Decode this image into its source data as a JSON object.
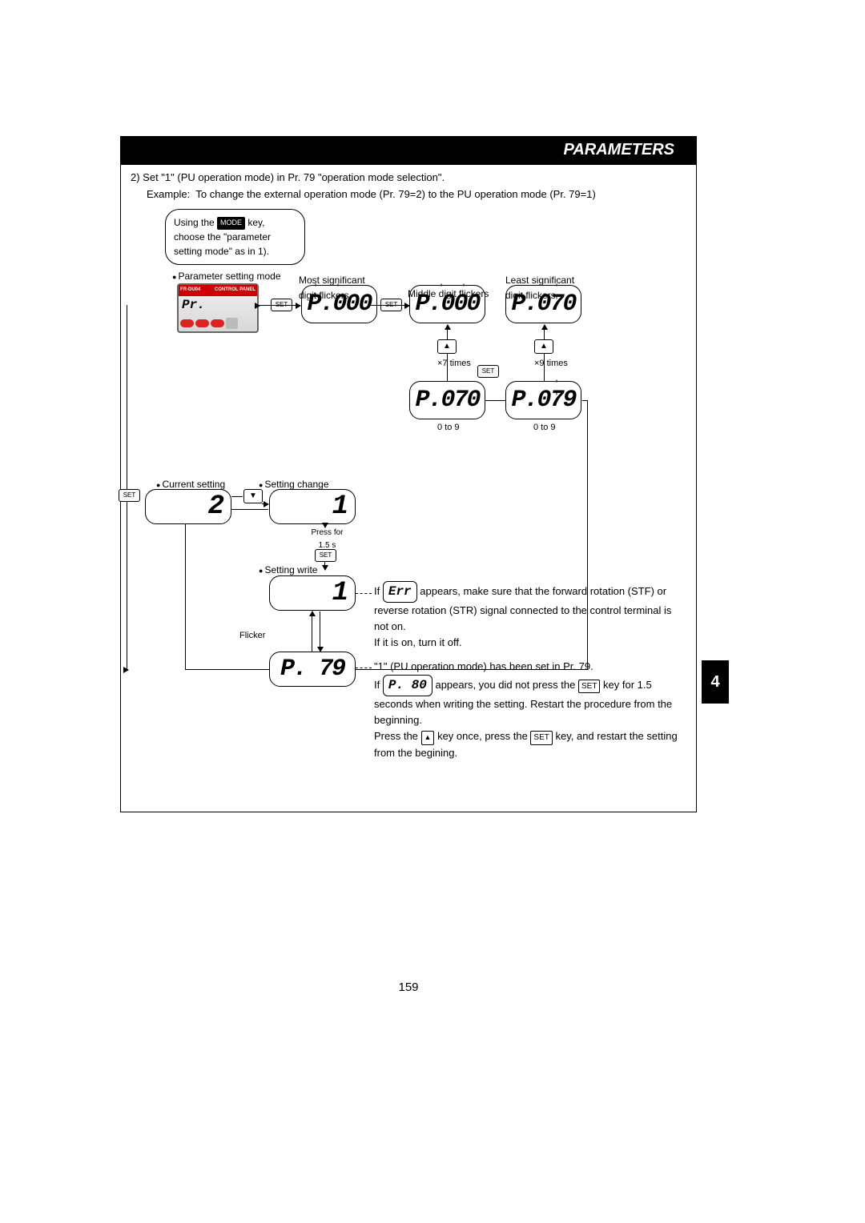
{
  "header": {
    "title": "PARAMETERS"
  },
  "intro": {
    "step": "2) Set \"1\" (PU operation mode) in Pr. 79 \"operation mode selection\".",
    "example": "Example:  To change the external operation mode (Pr. 79=2) to the PU operation mode (Pr. 79=1)"
  },
  "bubble": {
    "l1a": "Using the ",
    "key_mode": "MODE",
    "l1b": " key,",
    "l2": "choose the \"parameter",
    "l3": "setting mode\" as in 1)."
  },
  "panel": {
    "model": "FR-DU04",
    "ctrl": "CONTROL PANEL",
    "pr": "Pr."
  },
  "labels": {
    "param_mode": "Parameter setting mode",
    "msd1": "Most significant",
    "msd2": "digit flickers",
    "mid": "Middle digit flickers",
    "lsd1": "Least significant",
    "lsd2": "digit flickers",
    "x7": "×7 times",
    "x9": "×9 times",
    "range09_a": "0 to 9",
    "range09_b": "0 to 9",
    "current": "Current setting",
    "change": "Setting change",
    "press_for": "Press for",
    "time": "1.5 s",
    "write": "Setting write",
    "flicker": "Flicker"
  },
  "lcd": {
    "p000a": "P.000",
    "p000b": "P.000",
    "p070": "P.070",
    "p070b": "P.070",
    "p079": "P.079",
    "two": "2",
    "one": "1",
    "one2": "1",
    "p79": "P.  79"
  },
  "seg": {
    "err": "Err",
    "p80": "P.  80"
  },
  "btn": {
    "set": "SET"
  },
  "note1": {
    "a": "If ",
    "b": " appears, make sure that the forward rotation (STF) or reverse rotation (STR) signal connected to the control terminal is not on.",
    "c": "If it is on, turn it off."
  },
  "note2": {
    "a": "\"1\" (PU operation mode) has been set in Pr. 79.",
    "b": "If ",
    "c": " appears, you did not press the ",
    "set": "SET",
    "d": " key for 1.5 seconds when writing the setting. Restart the procedure from the beginning.",
    "e": "Press the ",
    "f": " key once, press the ",
    "g": " key, and restart the setting from the begining."
  },
  "sidebar": "4",
  "pageno": "159"
}
